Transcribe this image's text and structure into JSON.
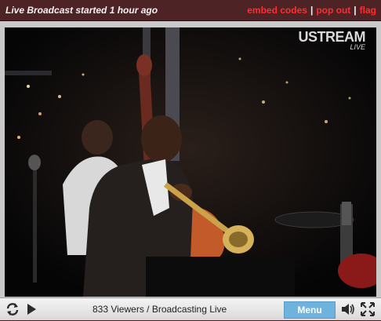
{
  "header": {
    "status": "Live Broadcast started 1 hour ago",
    "links": {
      "embed": "embed codes",
      "popout": "pop out",
      "flag": "flag"
    },
    "separator": "|"
  },
  "video": {
    "brand_logo": "USTREAM",
    "brand_badge": "LIVE"
  },
  "controls": {
    "refresh_icon": "refresh-icon",
    "play_icon": "play-icon",
    "viewers_text": "833 Viewers / Broadcasting Live",
    "menu_label": "Menu",
    "volume_icon": "volume-icon",
    "fullscreen_icon": "fullscreen-icon"
  },
  "colors": {
    "header_bg": "#4d2326",
    "link_red": "#ff2d2d",
    "menu_blue": "#6fb2de"
  }
}
